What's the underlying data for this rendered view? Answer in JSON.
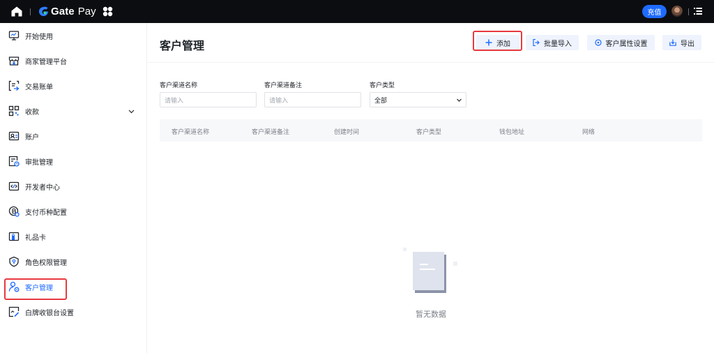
{
  "topbar": {
    "brand_strong": "Gate",
    "brand_light": "Pay",
    "recharge_label": "充值"
  },
  "sidebar": {
    "items": [
      {
        "label": "开始使用",
        "icon": "monitor-icon"
      },
      {
        "label": "商家管理平台",
        "icon": "store-icon"
      },
      {
        "label": "交易账单",
        "icon": "bill-icon"
      },
      {
        "label": "收款",
        "icon": "grid-icon"
      },
      {
        "label": "账户",
        "icon": "account-card-icon"
      },
      {
        "label": "审批管理",
        "icon": "approval-icon"
      },
      {
        "label": "开发者中心",
        "icon": "code-icon"
      },
      {
        "label": "支付币种配置",
        "icon": "coin-settings-icon"
      },
      {
        "label": "礼品卡",
        "icon": "gift-card-icon"
      },
      {
        "label": "角色权限管理",
        "icon": "shield-icon"
      },
      {
        "label": "客户管理",
        "icon": "customer-icon"
      },
      {
        "label": "白牌收银台设置",
        "icon": "cashier-icon"
      }
    ],
    "active_index": 10
  },
  "main": {
    "title": "客户管理",
    "buttons": {
      "add": "添加",
      "import": "批量导入",
      "attr": "客户属性设置",
      "export": "导出"
    },
    "filters": {
      "channel_name_label": "客户渠道名称",
      "channel_name_placeholder": "请输入",
      "channel_note_label": "客户渠道备注",
      "channel_note_placeholder": "请输入",
      "type_label": "客户类型",
      "type_value": "全部"
    },
    "table": {
      "columns": [
        "客户渠道名称",
        "客户渠道备注",
        "创建时间",
        "客户类型",
        "钱包地址",
        "网络"
      ]
    },
    "empty_text": "暂无数据"
  },
  "colors": {
    "accent": "#1e6bff",
    "highlight_red": "#e8393f",
    "topbar_bg": "#0c0d10",
    "button_bg": "#eef3fd"
  }
}
